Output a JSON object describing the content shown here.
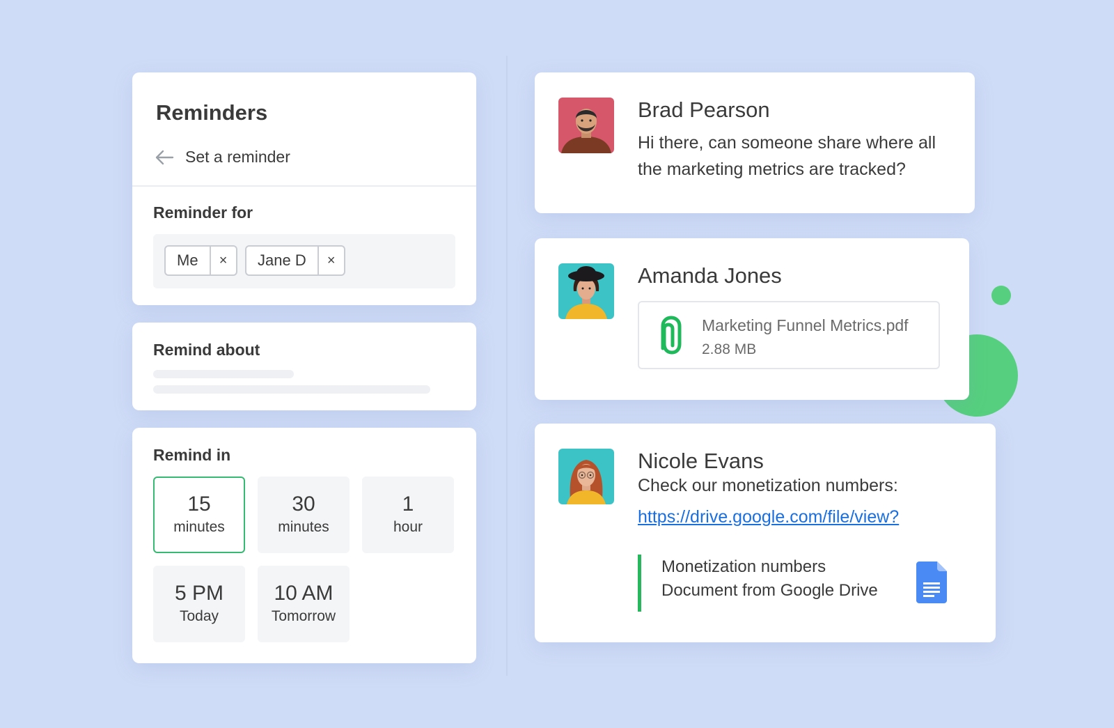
{
  "reminders": {
    "title": "Reminders",
    "back_label": "Set a reminder",
    "reminder_for_label": "Reminder for",
    "recipients": [
      {
        "name": "Me",
        "remove": "×"
      },
      {
        "name": "Jane D",
        "remove": "×"
      }
    ],
    "remind_about_label": "Remind about",
    "remind_in_label": "Remind in",
    "options": [
      {
        "big": "15",
        "small": "minutes",
        "selected": true
      },
      {
        "big": "30",
        "small": "minutes",
        "selected": false
      },
      {
        "big": "1",
        "small": "hour",
        "selected": false
      },
      {
        "big": "5 PM",
        "small": "Today",
        "selected": false
      },
      {
        "big": "10 AM",
        "small": "Tomorrow",
        "selected": false
      }
    ]
  },
  "messages": {
    "brad": {
      "name": "Brad Pearson",
      "text_line1": "Hi there, can someone share where all",
      "text_line2": "the marketing metrics are tracked?"
    },
    "amanda": {
      "name": "Amanda Jones",
      "file_name": "Marketing Funnel Metrics.pdf",
      "file_size": "2.88 MB"
    },
    "nicole": {
      "name": "Nicole Evans",
      "text": "Check our monetization numbers:",
      "link": "https://drive.google.com/file/view?",
      "preview_title": "Monetization numbers",
      "preview_subtitle": "Document from Google Drive"
    }
  },
  "colors": {
    "background": "#cfdcf7",
    "accent_green": "#36b970",
    "link_blue": "#1a6fe0",
    "doc_blue": "#4a8af4"
  },
  "icons": [
    "back-arrow-icon",
    "close-icon",
    "paperclip-icon",
    "google-docs-icon"
  ]
}
